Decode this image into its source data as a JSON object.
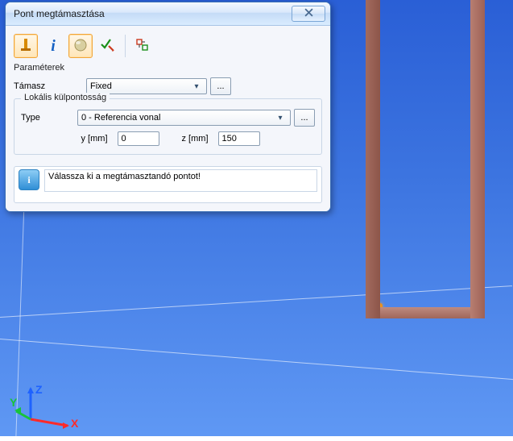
{
  "dialog": {
    "title": "Pont megtámasztása",
    "params_label": "Paraméterek",
    "support": {
      "label": "Támasz",
      "value": "Fixed",
      "more": "..."
    },
    "eccentricity": {
      "legend": "Lokális külpontosság",
      "type_label": "Type",
      "type_value": "0 - Referencia vonal",
      "more": "...",
      "y_label": "y [mm]",
      "y_value": "0",
      "z_label": "z [mm]",
      "z_value": "150"
    },
    "info": "Válassza ki a megtámasztandó pontot!"
  },
  "toolbar": {
    "icons": {
      "mode1": "column-support-icon",
      "info": "info-icon",
      "sphere_collection": "sphere-icon",
      "check": "check-edit-icon",
      "settings": "settings-icon"
    }
  },
  "gizmo": {
    "x": "X",
    "y": "Y",
    "z": "Z"
  },
  "colors": {
    "accent": "#f2a538",
    "win_border": "#3b6fb5",
    "column": "#9e6256"
  }
}
